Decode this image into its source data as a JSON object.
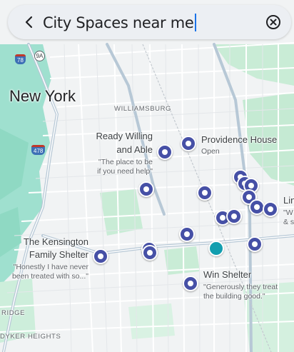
{
  "search": {
    "query": "City Spaces near me"
  },
  "icons": {
    "back": "arrow-back-icon",
    "clear": "cancel-circle-icon"
  },
  "colors": {
    "pin": "#4650a6",
    "current_location": "#129eaf",
    "park": "#c4ebd4",
    "water": "#aadaff"
  },
  "map": {
    "city": "New York",
    "neighborhoods": [
      "WILLIAMSBURG",
      "RIDGE",
      "DYKER HEIGHTS"
    ],
    "route_shields": [
      "78",
      "9A",
      "478"
    ]
  },
  "places": {
    "ready_willing": {
      "name_line1": "Ready Willing",
      "name_line2": "and Able",
      "sub_line1": "\"The place to be",
      "sub_line2": "if you need help\""
    },
    "providence": {
      "name": "Providence House",
      "sub": "Open"
    },
    "kensington": {
      "name_line1": "The Kensington",
      "name_line2": "Family Shelter",
      "sub_line1": "\"Honestly I have never",
      "sub_line2": "been treated with so...\""
    },
    "win": {
      "name": "Win Shelter",
      "sub_line1": "\"Generously they treat",
      "sub_line2": "the building  good.\""
    },
    "lin": {
      "name": "Lin",
      "sub_line1": "\"W",
      "sub_line2": "& s"
    }
  }
}
